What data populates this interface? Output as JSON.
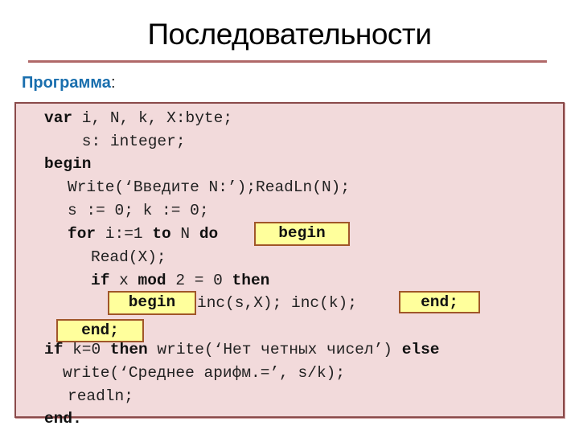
{
  "slide": {
    "title": "Последовательности",
    "subtitle": "Программа",
    "subtitle_colon": ":"
  },
  "code": {
    "lines": [
      {
        "kw1": "var",
        "rest": " i, N, k, X:byte;"
      },
      {
        "text": "    s: integer;"
      },
      {
        "kw1": "begin"
      },
      {
        "text": "Write(‘Введите N:’);ReadLn(N);"
      },
      {
        "text": "s := 0; k := 0;"
      },
      {
        "kw1": "for",
        "t1": " i:=1 ",
        "kw2": "to",
        "t2": " N ",
        "kw3": "do"
      },
      {
        "text": "Read(X);"
      },
      {
        "kw1": "if",
        "t1": " x ",
        "kw2": "mod",
        "t2": " 2 = 0 ",
        "kw3": "then"
      },
      {
        "text": "inc(s,X); inc(k);"
      },
      {
        "kw1": "if",
        "t1": " k=0 ",
        "kw2": "then",
        "t2": " write(‘Нет четных чисел’) ",
        "kw3": "else"
      },
      {
        "text": "write(‘Среднее арифм.=’, s/k);"
      },
      {
        "text": "readln;"
      },
      {
        "kw1": "end."
      }
    ],
    "highlights": {
      "for_begin": "begin",
      "then_begin": "begin",
      "then_end": "end;",
      "for_end": "end;"
    }
  },
  "colors": {
    "title_rule": "#b06868",
    "subtitle": "#1a6fae",
    "code_background": "#f2dadb",
    "code_border": "#8a4a4a",
    "highlight_fill": "#ffff9c",
    "highlight_border": "#a0562a"
  }
}
